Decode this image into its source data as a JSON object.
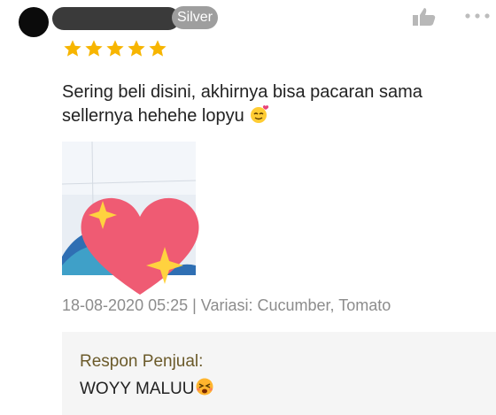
{
  "review": {
    "badge": "Silver",
    "rating": 5,
    "text": "Sering beli disini, akhirnya bisa pacaran sama sellernya hehehe lopyu",
    "text_emoji_icon": "smiling-face-with-hearts-icon",
    "meta": "18-08-2020 05:25 | Variasi: Cucumber, Tomato"
  },
  "seller_response": {
    "label": "Respon Penjual:",
    "text": "WOYY MALUU",
    "emoji_icon": "embarrassed-face-icon"
  },
  "colors": {
    "star": "#f7b500",
    "heart": "#ef5b73",
    "sparkle": "#ffd23f",
    "badge": "#9e9e9e",
    "reply_bg": "#f5f5f5",
    "reply_label": "#6b5a2a"
  }
}
